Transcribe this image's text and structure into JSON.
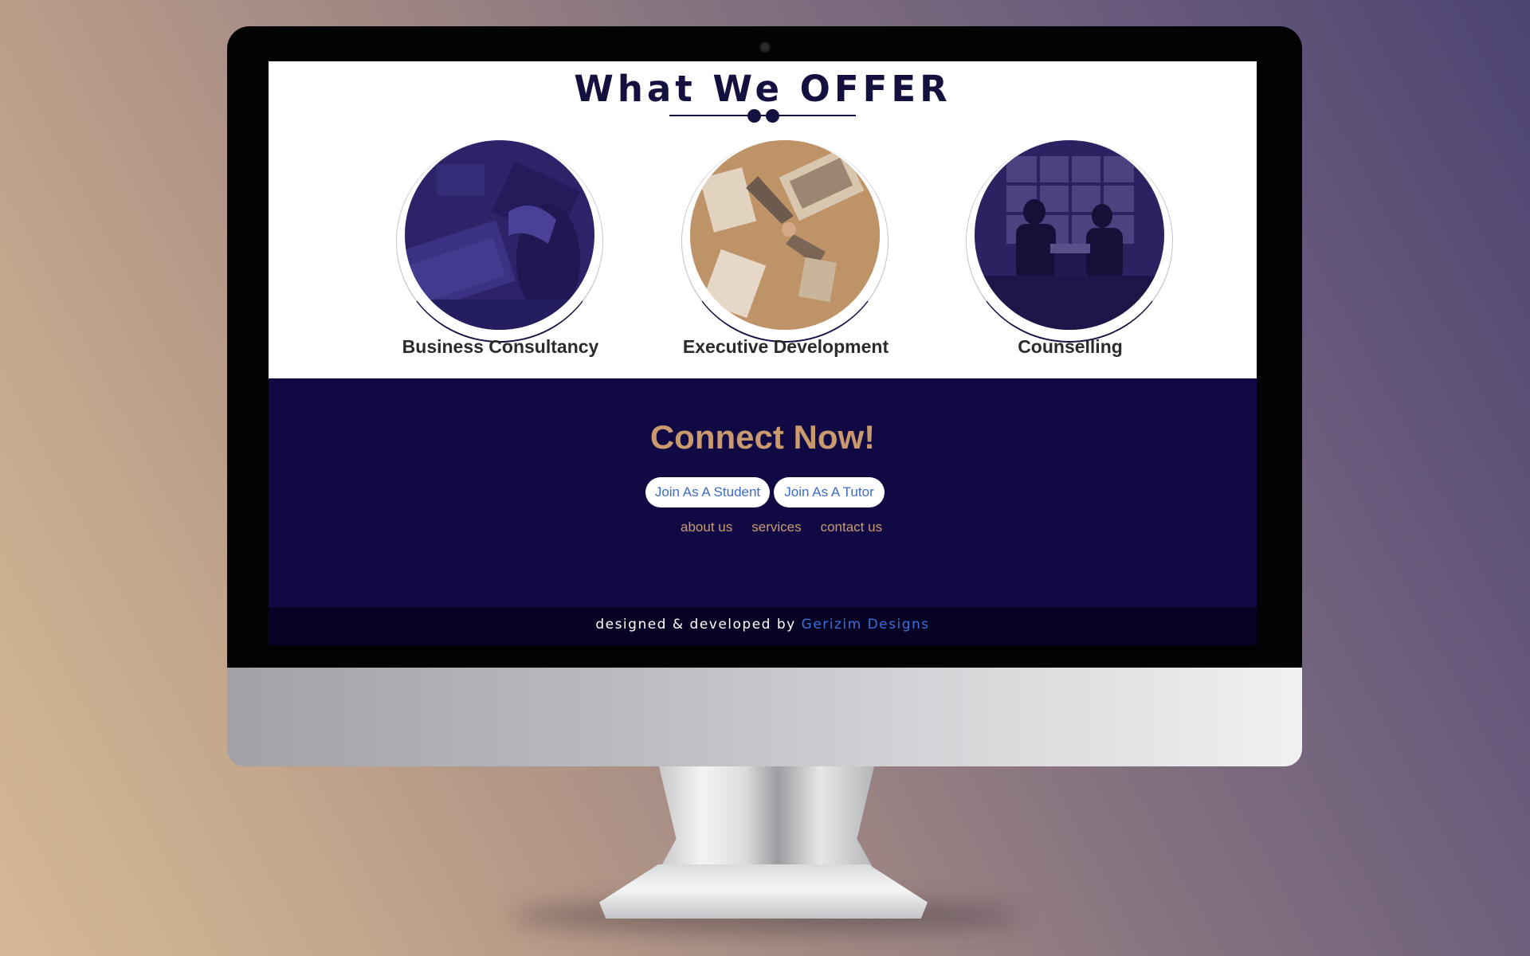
{
  "offer": {
    "title": "What We OFFER",
    "services": [
      {
        "label": "Business Consultancy",
        "image": "laptop-desk-photo"
      },
      {
        "label": "Executive Development",
        "image": "handshake-desk-photo"
      },
      {
        "label": "Counselling",
        "image": "meeting-room-photo"
      }
    ]
  },
  "connect": {
    "title": "Connect Now!",
    "buttons": {
      "student": "Join As A Student",
      "tutor": "Join As A Tutor"
    },
    "links": {
      "about": "about us",
      "services": "services",
      "contact": "contact us"
    }
  },
  "footer": {
    "credit_prefix": "designed & developed by ",
    "credit_link": "Gerizim Designs"
  },
  "colors": {
    "navy": "#110944",
    "accent": "#c99a6e",
    "link_blue": "#3b6fd6"
  }
}
